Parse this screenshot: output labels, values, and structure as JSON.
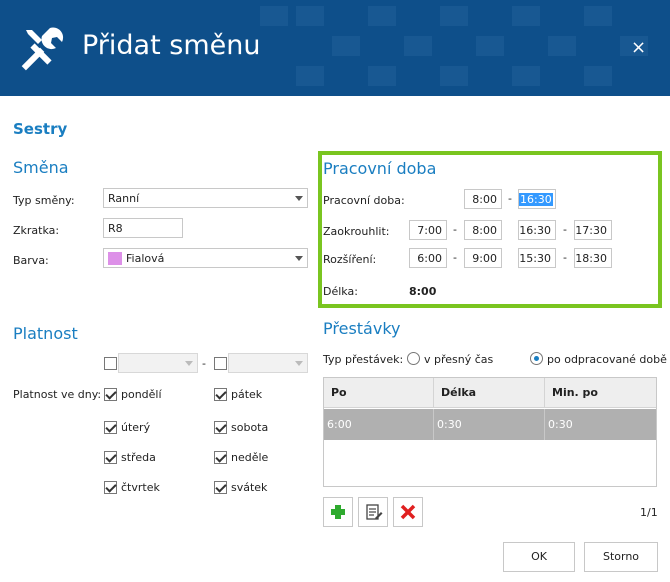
{
  "dialog": {
    "title": "Přidat směnu",
    "close_glyph": "×"
  },
  "group_title": "Sestry",
  "smena": {
    "title": "Směna",
    "typ_label": "Typ směny:",
    "typ_value": "Ranní",
    "zkratka_label": "Zkratka:",
    "zkratka_value": "R8",
    "barva_label": "Barva:",
    "barva_value": "Fialová",
    "barva_color": "#dd90e8"
  },
  "pracovni_doba": {
    "title": "Pracovní doba",
    "doba_label": "Pracovní doba:",
    "doba_from": "8:00",
    "doba_to": "16:30",
    "zaokrouhlit_label": "Zaokrouhlit:",
    "zaokrouhlit": [
      "7:00",
      "8:00",
      "16:30",
      "17:30"
    ],
    "rozsireni_label": "Rozšíření:",
    "rozsireni": [
      "6:00",
      "9:00",
      "15:30",
      "18:30"
    ],
    "delka_label": "Délka:",
    "delka_value": "8:00",
    "dash": "-"
  },
  "platnost": {
    "title": "Platnost",
    "dny_label": "Platnost ve dny:",
    "days": [
      {
        "label": "pondělí",
        "checked": true
      },
      {
        "label": "úterý",
        "checked": true
      },
      {
        "label": "středa",
        "checked": true
      },
      {
        "label": "čtvrtek",
        "checked": true
      },
      {
        "label": "pátek",
        "checked": true
      },
      {
        "label": "sobota",
        "checked": true
      },
      {
        "label": "neděle",
        "checked": true
      },
      {
        "label": "svátek",
        "checked": true
      }
    ]
  },
  "prestavky": {
    "title": "Přestávky",
    "typ_label": "Typ přestávek:",
    "option_exact": "v přesný čas",
    "option_after": "po odpracované době",
    "selected": "option_after",
    "columns": [
      "Po",
      "Délka",
      "Min. po"
    ],
    "rows": [
      [
        "6:00",
        "0:30",
        "0:30"
      ]
    ],
    "pager": "1/1"
  },
  "buttons": {
    "ok": "OK",
    "cancel": "Storno"
  },
  "colors": {
    "header": "#0e4f8a",
    "accent": "#1a7ec1",
    "highlight_border": "#7ac520",
    "add": "#2eaa2e",
    "delete": "#e02020"
  }
}
